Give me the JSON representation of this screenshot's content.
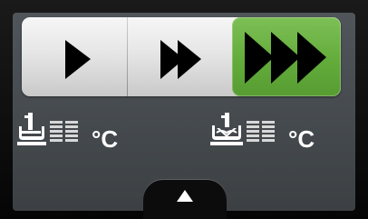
{
  "speed_selector": {
    "levels": [
      {
        "name": "speed-1",
        "arrows": 1,
        "active": false
      },
      {
        "name": "speed-2",
        "arrows": 2,
        "active": false
      },
      {
        "name": "speed-3",
        "arrows": 3,
        "active": true
      }
    ],
    "active_color": "#63ac3b"
  },
  "temperatures": {
    "left": {
      "icon": "heating-element-icon",
      "value": "",
      "unit": "°C"
    },
    "right": {
      "icon": "fan-heating-icon",
      "value": "",
      "unit": "°C"
    }
  },
  "drawer": {
    "icon": "triangle-up-icon"
  }
}
